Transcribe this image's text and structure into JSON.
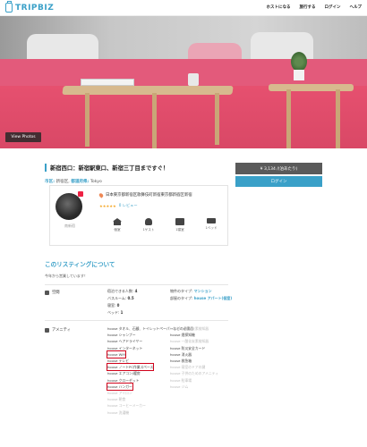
{
  "header": {
    "logo": "TRIPBIZ",
    "nav": [
      "ホストになる",
      "旅行する",
      "ログイン",
      "ヘルプ"
    ]
  },
  "hero": {
    "view_photos_label": "View Photos"
  },
  "listing": {
    "title": "新宿西口：新宿駅東口、新宿三丁目まですぐ！",
    "location_prefix": "市区:",
    "location_area": "新宿区",
    "location_detail_label": "都道府県:",
    "location_city": "Tokyo"
  },
  "sidebar": {
    "price": "¥ 3,134 /(泊あたり)",
    "login": "ログイン"
  },
  "host": {
    "name": "南新宿",
    "address": "日本東京都新宿区歌舞伎町新宿東京都新宿区新宿",
    "stars": "★★★★★",
    "reviews": "0 レビュー",
    "stats": [
      {
        "icon": "house-icon",
        "label": "個室"
      },
      {
        "icon": "person-icon",
        "label": "1ゲスト"
      },
      {
        "icon": "room-icon",
        "label": "1寝室"
      },
      {
        "icon": "bed-icon",
        "label": "1ベッド"
      }
    ]
  },
  "about": {
    "title": "このリスティングについて",
    "subtitle": "今年から営業しています！",
    "space_label": "空間",
    "space_left": [
      {
        "k": "宿泊できる人数:",
        "v": "4"
      },
      {
        "k": "バスルーム:",
        "v": "0.5"
      },
      {
        "k": "寝室:",
        "v": "0"
      },
      {
        "k": "ベッド:",
        "v": "1"
      }
    ],
    "space_right": [
      {
        "k": "物件のタイプ:",
        "v": "マンション"
      },
      {
        "k": "部屋のタイプ:",
        "v": "house アパート(個室)"
      }
    ],
    "amenities_label": "アメニティ",
    "amenities_left": [
      {
        "t": "house タオル、石鹸、トイレットペーパーなどの必需品",
        "on": true,
        "boxed": false
      },
      {
        "t": "house シャンプー",
        "on": true,
        "boxed": false
      },
      {
        "t": "house ヘアドライヤー",
        "on": true,
        "boxed": false
      },
      {
        "t": "house インターネット",
        "on": true,
        "boxed": false
      },
      {
        "t": "house Wifi",
        "on": true,
        "boxed": true
      },
      {
        "t": "house テレビ",
        "on": true,
        "boxed": false
      },
      {
        "t": "house ノートPC作業スペース",
        "on": true,
        "boxed": true
      },
      {
        "t": "house エアコン/暖房",
        "on": true,
        "boxed": false
      },
      {
        "t": "house クローゼット",
        "on": true,
        "boxed": false
      },
      {
        "t": "house ハンガー",
        "on": true,
        "boxed": true
      },
      {
        "t": "house アイロン",
        "on": false,
        "boxed": false
      },
      {
        "t": "house 朝食",
        "on": false,
        "boxed": false
      },
      {
        "t": "house コーヒーメーカー",
        "on": false,
        "boxed": false
      },
      {
        "t": "house 洗濯機",
        "on": false,
        "boxed": false
      }
    ],
    "amenities_right": [
      {
        "t": "house 一酸化炭素検知器",
        "on": false
      },
      {
        "t": "house 煙探知機",
        "on": true
      },
      {
        "t": "house 一酸化炭素検知器",
        "on": false
      },
      {
        "t": "house 防災安全カード",
        "on": true
      },
      {
        "t": "house 消火器",
        "on": true
      },
      {
        "t": "house 救急箱",
        "on": true
      },
      {
        "t": "house 寝室のドアの鍵",
        "on": false
      },
      {
        "t": "house 子供のためのアメニティ",
        "on": false
      },
      {
        "t": "house 駐車場",
        "on": false
      },
      {
        "t": "house ジム",
        "on": false
      }
    ]
  }
}
